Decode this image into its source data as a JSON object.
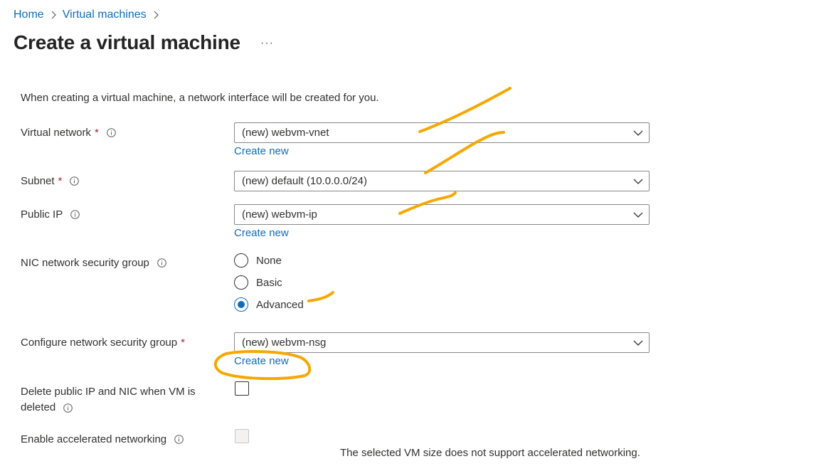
{
  "breadcrumb": {
    "items": [
      "Home",
      "Virtual machines"
    ]
  },
  "header": {
    "title": "Create a virtual machine",
    "more": "···"
  },
  "intro": "When creating a virtual machine, a network interface will be created for you.",
  "fields": {
    "virtual_network": {
      "label": "Virtual network",
      "required": "*",
      "value": "(new) webvm-vnet",
      "link": "Create new"
    },
    "subnet": {
      "label": "Subnet",
      "required": "*",
      "value": "(new) default (10.0.0.0/24)"
    },
    "public_ip": {
      "label": "Public IP",
      "value": "(new) webvm-ip",
      "link": "Create new"
    },
    "nic_nsg": {
      "label": "NIC network security group",
      "options": [
        "None",
        "Basic",
        "Advanced"
      ],
      "selected": "Advanced"
    },
    "configure_nsg": {
      "label": "Configure network security group",
      "required": "*",
      "value": "(new) webvm-nsg",
      "link": "Create new"
    },
    "delete_public_ip": {
      "label_line1": "Delete public IP and NIC when VM is",
      "label_line2": "deleted",
      "checked": false
    },
    "accelerated_networking": {
      "label": "Enable accelerated networking",
      "checked": false,
      "disabled": true,
      "note": "The selected VM size does not support accelerated networking."
    }
  },
  "colors": {
    "link": "#0f6cbd",
    "required": "#a4262c",
    "annotation": "#f5a800"
  },
  "icons": [
    "chevron-right-icon",
    "info-icon",
    "chevron-down-icon"
  ]
}
